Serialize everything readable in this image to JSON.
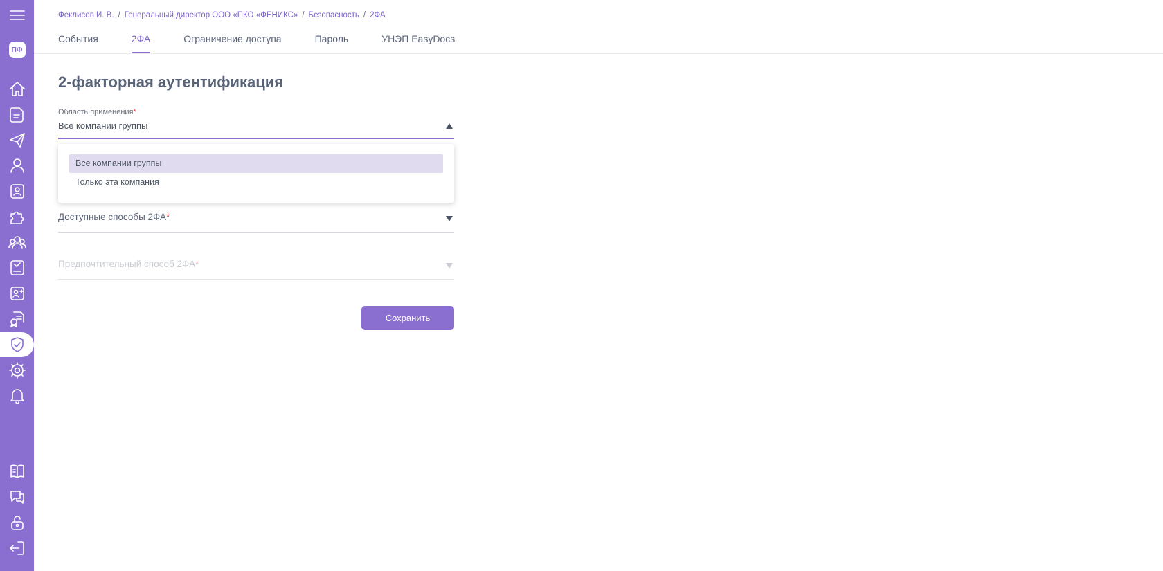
{
  "sidebar": {
    "avatar_initials": "ПФ",
    "icons": [
      "menu-icon",
      "avatar",
      "home-icon",
      "document-icon",
      "send-icon",
      "user-icon",
      "badge-icon",
      "puzzle-icon",
      "team-icon",
      "book-icon",
      "contact-add-icon",
      "certificate-icon",
      "shield-check-icon",
      "gear-icon",
      "bell-icon",
      "guide-book-icon",
      "chat-support-icon",
      "unlock-icon",
      "logout-icon"
    ],
    "active_item": "shield-check-icon",
    "accent_color": "#8a6fd0"
  },
  "breadcrumb": {
    "items": [
      "Феклисов И. В.",
      "Генеральный директор ООО «ПКО «ФЕНИКС»",
      "Безопасность",
      "2ФА"
    ],
    "separator": "/"
  },
  "tabs": {
    "items": [
      "События",
      "2ФА",
      "Ограничение доступа",
      "Пароль",
      "УНЭП EasyDocs"
    ],
    "active_index": 1
  },
  "page": {
    "title": "2-факторная аутентификация"
  },
  "form": {
    "scope": {
      "label": "Область применения",
      "required_mark": "*",
      "value": "Все компании группы",
      "options": [
        "Все компании группы",
        "Только эта компания"
      ],
      "selected_index": 0,
      "expanded": true
    },
    "methods": {
      "label": "Доступные способы 2ФА",
      "required_mark": "*"
    },
    "preferred": {
      "label": "Предпочтительный способ 2ФА",
      "required_mark": "*",
      "disabled": true
    },
    "save_label": "Сохранить"
  }
}
